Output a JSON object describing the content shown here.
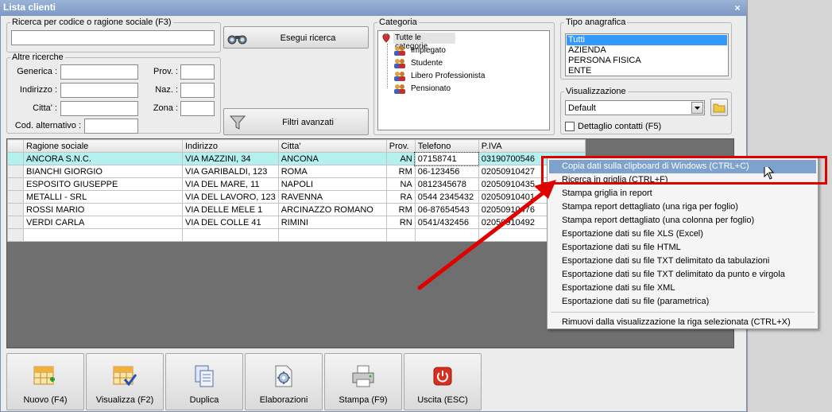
{
  "window": {
    "title": "Lista clienti",
    "close_glyph": "×"
  },
  "search": {
    "group_label": "Ricerca per codice o ragione sociale (F3)",
    "value": "",
    "button_label": "Esegui ricerca",
    "button_icon": "binoculars-icon"
  },
  "other_searches": {
    "group_label": "Altre ricerche",
    "generica_label": "Generica :",
    "indirizzo_label": "Indirizzo :",
    "citta_label": "Citta' :",
    "cod_alt_label": "Cod. alternativo :",
    "prov_label": "Prov. :",
    "naz_label": "Naz. :",
    "zona_label": "Zona :"
  },
  "advanced_filters": {
    "label": "Filtri avanzati",
    "icon": "funnel-icon"
  },
  "category": {
    "group_label": "Categoria",
    "root": "Tutte le categorie",
    "items": [
      "Impiegato",
      "Studente",
      "Libero Professionista",
      "Pensionato"
    ]
  },
  "tipo_anagrafica": {
    "group_label": "Tipo anagrafica",
    "options": [
      "Tutti",
      "AZIENDA",
      "PERSONA FISICA",
      "ENTE"
    ],
    "selected_index": 0
  },
  "visualizzazione": {
    "group_label": "Visualizzazione",
    "selected": "Default",
    "detail_checkbox_label": "Dettaglio contatti (F5)",
    "detail_checked": false
  },
  "grid": {
    "columns": [
      "Ragione sociale",
      "Indirizzo",
      "Citta'",
      "Prov.",
      "Telefono",
      "P.IVA"
    ],
    "rows": [
      [
        "ANCORA S.N.C.",
        "VIA MAZZINI, 34",
        "ANCONA",
        "AN",
        "07158741",
        "03190700546"
      ],
      [
        "BIANCHI GIORGIO",
        "VIA GARIBALDI, 123",
        "ROMA",
        "RM",
        "06-123456",
        "02050910427"
      ],
      [
        "ESPOSITO GIUSEPPE",
        "VIA DEL MARE, 11",
        "NAPOLI",
        "NA",
        "0812345678",
        "02050910435"
      ],
      [
        "METALLI - SRL",
        "VIA DEL LAVORO, 123",
        "RAVENNA",
        "RA",
        "0544 2345432",
        "02050910401"
      ],
      [
        "ROSSI MARIO",
        "VIA DELLE MELE 1",
        "ARCINAZZO ROMANO",
        "RM",
        "06-87654543",
        "02050910476"
      ],
      [
        "VERDI CARLA",
        "VIA DEL COLLE 41",
        "RIMINI",
        "RN",
        "0541/432456",
        "02050910492"
      ]
    ],
    "selected_row": 0
  },
  "context_menu": {
    "items": [
      "Copia dati sulla clipboard di Windows (CTRL+C)",
      "Ricerca in griglia (CTRL+F)",
      "Stampa griglia in report",
      "Stampa report dettagliato (una riga per foglio)",
      "Stampa report dettagliato (una colonna per foglio)",
      "Esportazione dati su file XLS (Excel)",
      "Esportazione dati su file HTML",
      "Esportazione dati su file TXT delimitato da tabulazioni",
      "Esportazione dati su file TXT delimitato da punto e virgola",
      "Esportazione dati su file XML",
      "Esportazione dati su file (parametrica)",
      "Rimuovi dalla visualizzazione la riga selezionata (CTRL+X)"
    ],
    "highlighted_index": 0
  },
  "toolbar": {
    "buttons": [
      {
        "label": "Nuovo (F4)",
        "icon": "grid-add-icon"
      },
      {
        "label": "Visualizza (F2)",
        "icon": "grid-check-icon"
      },
      {
        "label": "Duplica",
        "icon": "duplicate-icon"
      },
      {
        "label": "Elaborazioni",
        "icon": "gear-document-icon"
      },
      {
        "label": "Stampa (F9)",
        "icon": "printer-icon"
      },
      {
        "label": "Uscita (ESC)",
        "icon": "power-icon"
      }
    ]
  },
  "colors": {
    "title_bar": "#8aa5cd",
    "selected_row": "#b4f0ee",
    "menu_highlight": "#7da2ce",
    "annotation_red": "#e00000",
    "list_selection": "#3399ff"
  }
}
